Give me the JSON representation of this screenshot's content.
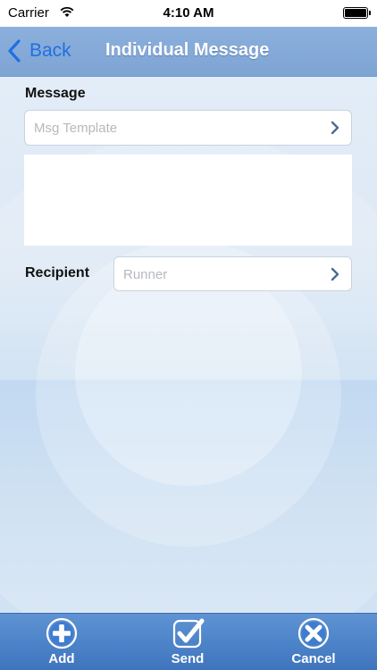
{
  "status_bar": {
    "carrier": "Carrier",
    "time": "4:10 AM",
    "icons": [
      "wifi-icon",
      "battery-icon"
    ]
  },
  "nav": {
    "back_label": "Back",
    "title": "Individual Message",
    "back_icon": "chevron-left-icon"
  },
  "form": {
    "message_label": "Message",
    "template_placeholder": "Msg Template",
    "message_text": "",
    "recipient_label": "Recipient",
    "recipient_placeholder": "Runner",
    "chevron_icon": "chevron-right-icon"
  },
  "toolbar": {
    "add_label": "Add",
    "send_label": "Send",
    "cancel_label": "Cancel",
    "icons": [
      "plus-circle-icon",
      "check-icon",
      "close-circle-icon"
    ]
  },
  "colors": {
    "nav_bar": "#8cb0dc",
    "accent": "#1f6fe3",
    "tab_bar": "#4d84c9",
    "chevron": "#4a6c92"
  }
}
